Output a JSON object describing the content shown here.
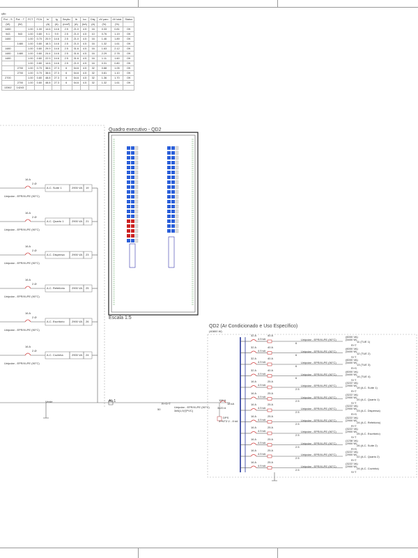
{
  "frame": {
    "corner_top": "",
    "corner_bottom": ""
  },
  "table": {
    "section_label": "ção",
    "headers": [
      [
        "Pot. - S",
        "Pot. - T",
        "FCT",
        "FCA",
        "In'",
        "Ig",
        "Seção",
        "Ib",
        "Icc",
        "Disj.",
        "dV parc.",
        "dV total",
        "Status"
      ],
      [
        "(W)",
        "(W)",
        "",
        "",
        "(A)",
        "(A)",
        "(mm²)",
        "(A)",
        "(kA)",
        "(A)",
        "(%)",
        "(%)",
        ""
      ]
    ],
    "rows": [
      [
        "1480",
        "",
        "1.00",
        "1.00",
        "14.6",
        "14.6",
        "2.5",
        "21.0",
        "4.5",
        "16",
        "0.33",
        "0.81",
        "OK"
      ],
      [
        "943",
        "943",
        "1.00",
        "0.80",
        "9.1",
        "9.9",
        "2.5",
        "21.0",
        "4.5",
        "10",
        "0.76",
        "1.19",
        "OK"
      ],
      [
        "1480",
        "",
        "1.00",
        "0.70",
        "20.9",
        "14.6",
        "2.5",
        "21.0",
        "4.5",
        "16",
        "1.46",
        "1.89",
        "OK"
      ],
      [
        "",
        "1480",
        "1.00",
        "0.80",
        "18.3",
        "14.6",
        "2.5",
        "21.0",
        "4.5",
        "16",
        "1.32",
        "1.61",
        "OK"
      ],
      [
        "1480",
        "",
        "1.00",
        "0.80",
        "29.9",
        "14.6",
        "2.5",
        "31.6",
        "4.5",
        "16",
        "1.63",
        "2.12",
        "OK"
      ],
      [
        "1480",
        "1480",
        "1.00",
        "0.80",
        "24.4",
        "14.6",
        "2.5",
        "31.6",
        "4.5",
        "16",
        "2.29",
        "2.78",
        "OK"
      ],
      [
        "1480",
        "",
        "1.00",
        "0.80",
        "22.9",
        "14.6",
        "2.5",
        "31.6",
        "4.5",
        "16",
        "1.11",
        "1.60",
        "OK"
      ],
      [
        "",
        "",
        "1.00",
        "0.80",
        "14.6",
        "14.6",
        "2.5",
        "21.0",
        "4.5",
        "16",
        "0.31",
        "0.80",
        "OK"
      ],
      [
        "",
        "2700",
        "1.00",
        "0.70",
        "38.6",
        "27.3",
        "6",
        "54.6",
        "4.5",
        "32",
        "0.88",
        "1.05",
        "OK"
      ],
      [
        "",
        "2700",
        "1.00",
        "0.70",
        "38.6",
        "27.3",
        "6",
        "54.6",
        "4.5",
        "32",
        "0.81",
        "1.10",
        "OK"
      ],
      [
        "2700",
        "",
        "1.00",
        "0.80",
        "48.8",
        "27.3",
        "6",
        "54.6",
        "4.5",
        "32",
        "1.36",
        "1.70",
        "OK"
      ],
      [
        "",
        "2700",
        "1.00",
        "0.80",
        "48.8",
        "27.3",
        "6",
        "54.6",
        "4.5",
        "32",
        "1.32",
        "1.61",
        "OK"
      ],
      [
        "13362",
        "14243",
        "",
        "",
        "",
        "",
        "",
        "",
        "",
        "",
        "",
        "",
        ""
      ]
    ]
  },
  "left_circuits": [
    {
      "breaker": "16 A",
      "breaker_sub": "2 Ø",
      "name": "A.C. Suíte 1",
      "power": "2900 VA",
      "num": "19",
      "cable": "Unipolar - EPR/XLPE (90°C)"
    },
    {
      "breaker": "16 A",
      "breaker_sub": "2 Ø",
      "name": "A.C. Quarto 1",
      "power": "2900 VA",
      "num": "21",
      "cable": "Unipolar - EPR/XLPE (90°C)"
    },
    {
      "breaker": "16 A",
      "breaker_sub": "2 Ø",
      "name": "A.C. Dispensa",
      "power": "2900 VA",
      "num": "23",
      "cable": "Unipolar - EPR/XLPE (90°C)"
    },
    {
      "breaker": "16 A",
      "breaker_sub": "2 Ø",
      "name": "A.C. Refeitório",
      "power": "2900 VA",
      "num": "25",
      "cable": "Unipolar - EPR/XLPE (90°C)"
    },
    {
      "breaker": "16 A",
      "breaker_sub": "2 Ø",
      "name": "A.C. Escritório",
      "power": "2900 VA",
      "num": "26",
      "cable": "Unipolar - EPR/XLPE (90°C)"
    },
    {
      "breaker": "16 A",
      "breaker_sub": "2 Ø",
      "name": "A.C. Cozinha",
      "power": "2900 VA",
      "num": "24",
      "cable": "Unipolar - EPR/XLPE (90°C)"
    }
  ],
  "left_panel": {
    "ground_label": "Verde"
  },
  "qd2_exec": {
    "title": "Quadro executivo - QD2",
    "scale": "Escala 1:5"
  },
  "qd2_diag": {
    "title": "QD2 (Ar Condicionado e Uso Específico)",
    "subtitle": "(40800 W)"
  },
  "feeder": {
    "tag": "AL 1",
    "phases": "R+S+T",
    "size": "50",
    "cable": "Unipolar - EPR/XLPE (90°C)",
    "cable_detail": "3#6(1,5)\"[PVC]",
    "main_breaker": "100 A",
    "main_breaker_sub": "3x20 A",
    "main_breaker_ka": "18 kA",
    "dps": "DPS",
    "dps_detail": "3+NT3 V - 8 kA"
  },
  "right_circuits": [
    {
      "breaker": "32 A",
      "idr": "40 A",
      "ka": "4.5 kA",
      "cable": "Unipolar - EPR/XLPE (90°C)",
      "section": "6",
      "power": "(6000 VA)",
      "power2": "(5400 W)",
      "num": "11 (TUE 1)",
      "phases": "R+T"
    },
    {
      "breaker": "32 A",
      "idr": "40 A",
      "ka": "4.5 kA",
      "cable": "Unipolar - EPR/XLPE (90°C)",
      "section": "6",
      "power": "(6000 VA)",
      "power2": "(5400 W)",
      "num": "12 (TUE 2)",
      "phases": "S+T"
    },
    {
      "breaker": "32 A",
      "idr": "40 A",
      "ka": "4.5 kA",
      "cable": "Unipolar - EPR/XLPE (90°C)",
      "section": "6",
      "power": "(6000 VA)",
      "power2": "(5400 W)",
      "num": "13 (TUE 3)",
      "phases": "R+S"
    },
    {
      "breaker": "32 A",
      "idr": "40 A",
      "ka": "4.5 kA",
      "cable": "Unipolar - EPR/XLPE (90°C)",
      "section": "6",
      "power": "(6000 VA)",
      "power2": "(5400 W)",
      "num": "14 (TUE 4)",
      "phases": "S+T"
    },
    {
      "breaker": "16 A",
      "idr": "25 A",
      "ka": "4.5 kA",
      "cable": "Unipolar - EPR/XLPE (90°C)",
      "section": "2.5",
      "power": "(3222 VA)",
      "power2": "(2900 W)",
      "num": "19 (A.C. Suíte 1)",
      "phases": "R+T"
    },
    {
      "breaker": "16 A",
      "idr": "25 A",
      "ka": "4.5 kA",
      "cable": "Unipolar - EPR/XLPE (90°C)",
      "section": "2.5",
      "power": "(3222 VA)",
      "power2": "(2900 W)",
      "num": "20 (A.C. Quarto 1)",
      "phases": "S+T"
    },
    {
      "breaker": "16 A",
      "idr": "25 A",
      "ka": "4.5 kA",
      "cable": "Unipolar - EPR/XLPE (90°C)",
      "section": "2.5",
      "power": "(3222 VA)",
      "power2": "(2900 W)",
      "num": "23 (A.C. Dispensa)",
      "phases": "R+S"
    },
    {
      "breaker": "16 A",
      "idr": "25 A",
      "ka": "4.5 kA",
      "cable": "Unipolar - EPR/XLPE (90°C)",
      "section": "2.5",
      "power": "(3222 VA)",
      "power2": "(2900 W)",
      "num": "24 (A.C. Refeitório)",
      "phases": "R+T"
    },
    {
      "breaker": "16 A",
      "idr": "25 A",
      "ka": "4.5 kA",
      "cable": "Unipolar - EPR/XLPE (90°C)",
      "section": "2.5",
      "power": "(3222 VA)",
      "power2": "(2900 W)",
      "num": "25 (A.C. Escritório)",
      "phases": "S+T"
    },
    {
      "breaker": "16 A",
      "idr": "25 A",
      "ka": "4.5 kA",
      "cable": "Unipolar - EPR/XLPE (90°C)",
      "section": "2.5",
      "power": "(1238 VA)",
      "power2": "(2900 W)",
      "num": "26 (A.C. Suíte 2)",
      "phases": "R+S"
    },
    {
      "breaker": "16 A",
      "idr": "25 A",
      "ka": "4.5 kA",
      "cable": "Unipolar - EPR/XLPE (90°C)",
      "section": "2.5",
      "power": "(3222 VA)",
      "power2": "(2900 W)",
      "num": "22 (A.C. Quarto 2)",
      "phases": "R+T"
    },
    {
      "breaker": "16 A",
      "idr": "25 A",
      "ka": "4.5 kA",
      "cable": "Unipolar - EPR/XLPE (90°C)",
      "section": "2.5",
      "power": "(3222 VA)",
      "power2": "(2900 W)",
      "num": "24 (A.C. Cozinha)",
      "phases": "S+T"
    }
  ],
  "colors": {
    "breaker_blue": "#2b5fd9",
    "breaker_red": "#cc2222",
    "circuit_red": "#d04040",
    "frame": "#999999",
    "line": "#555555"
  }
}
